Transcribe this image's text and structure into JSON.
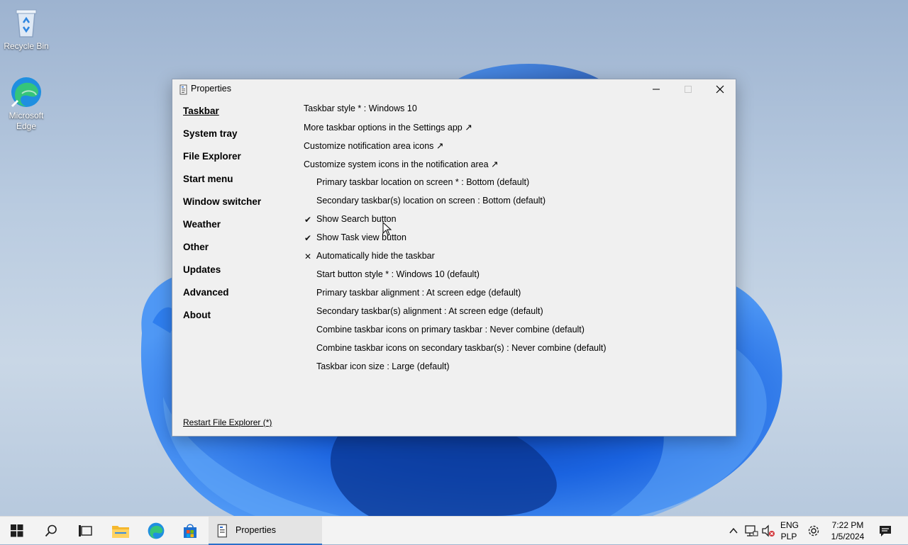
{
  "desktop": {
    "icons": [
      {
        "label": "Recycle Bin"
      },
      {
        "label_line1": "Microsoft",
        "label_line2": "Edge"
      }
    ]
  },
  "window": {
    "title": "Properties",
    "nav": [
      {
        "label": "Taskbar",
        "active": true
      },
      {
        "label": "System tray"
      },
      {
        "label": "File Explorer"
      },
      {
        "label": "Start menu"
      },
      {
        "label": "Window switcher"
      },
      {
        "label": "Weather"
      },
      {
        "label": "Other"
      },
      {
        "label": "Updates"
      },
      {
        "label": "Advanced"
      },
      {
        "label": "About"
      }
    ],
    "options": [
      {
        "text": "Taskbar style * : Windows 10"
      },
      {
        "text": "More taskbar options in the Settings app ↗"
      },
      {
        "text": "Customize notification area icons ↗"
      },
      {
        "text": "Customize system icons in the notification area ↗"
      },
      {
        "text": "Primary taskbar location on screen * : Bottom (default)"
      },
      {
        "text": "Secondary taskbar(s) location on screen : Bottom (default)"
      },
      {
        "text": "Show Search button",
        "mark": "✔"
      },
      {
        "text": "Show Task view button",
        "mark": "✔"
      },
      {
        "text": "Automatically hide the taskbar",
        "mark": "✕"
      },
      {
        "text": "Start button style * : Windows 10 (default)"
      },
      {
        "text": "Primary taskbar alignment : At screen edge (default)"
      },
      {
        "text": "Secondary taskbar(s) alignment : At screen edge (default)"
      },
      {
        "text": "Combine taskbar icons on primary taskbar : Never combine (default)"
      },
      {
        "text": "Combine taskbar icons on secondary taskbar(s) : Never combine (default)"
      },
      {
        "text": "Taskbar icon size : Large (default)"
      }
    ],
    "restart_link": "Restart File Explorer (*)"
  },
  "taskbar": {
    "active_app_label": "Properties",
    "lang_line1": "ENG",
    "lang_line2": "PLP",
    "time": "7:22 PM",
    "date": "1/5/2024",
    "accent_color": "#2a6fc9"
  }
}
